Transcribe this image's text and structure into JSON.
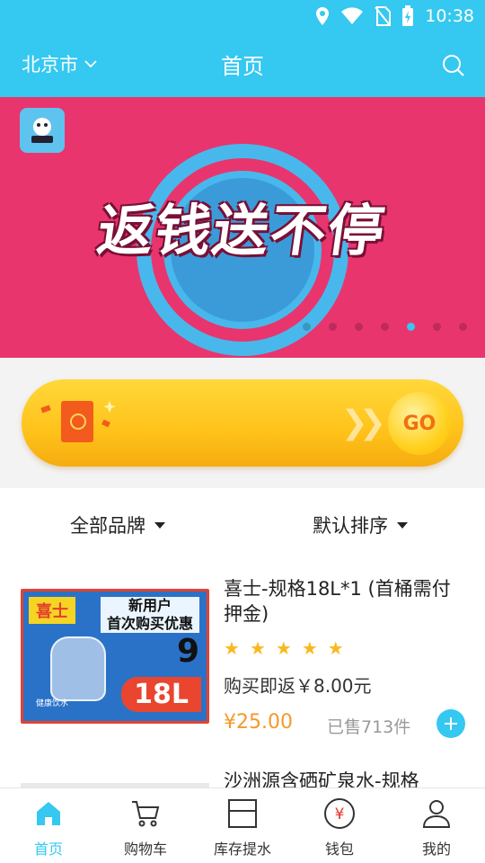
{
  "status_bar": {
    "time": "10:38"
  },
  "header": {
    "city": "北京市",
    "title": "首页"
  },
  "banner": {
    "headline": "返钱送不停",
    "slide_count": 7,
    "active_slide": 5
  },
  "promo": {
    "go_label": "GO"
  },
  "filters": {
    "brand_label": "全部品牌",
    "sort_label": "默认排序"
  },
  "products": [
    {
      "name": "喜士-规格18L*1 (首桶需付押金)",
      "image_tag": "喜士",
      "image_promo_line1": "新用户",
      "image_promo_line2": "首次购买优惠",
      "image_promo_digit": "9",
      "image_volume": "18L",
      "image_small_text": "健康饮水",
      "rating_stars": 5,
      "rebate_text": "购买即返￥8.00元",
      "price": "¥25.00",
      "sold": "已售713件"
    },
    {
      "name": "沙洲源含硒矿泉水-规格"
    }
  ],
  "bottom_nav": [
    {
      "label": "首页",
      "icon": "home-icon",
      "active": true
    },
    {
      "label": "购物车",
      "icon": "cart-icon",
      "active": false
    },
    {
      "label": "库存提水",
      "icon": "inventory-icon",
      "active": false
    },
    {
      "label": "钱包",
      "icon": "wallet-icon",
      "active": false
    },
    {
      "label": "我的",
      "icon": "profile-icon",
      "active": false
    }
  ],
  "colors": {
    "primary": "#35c8f0",
    "banner_bg": "#e8356e",
    "price": "#f39a2b",
    "star": "#f9b81e"
  }
}
